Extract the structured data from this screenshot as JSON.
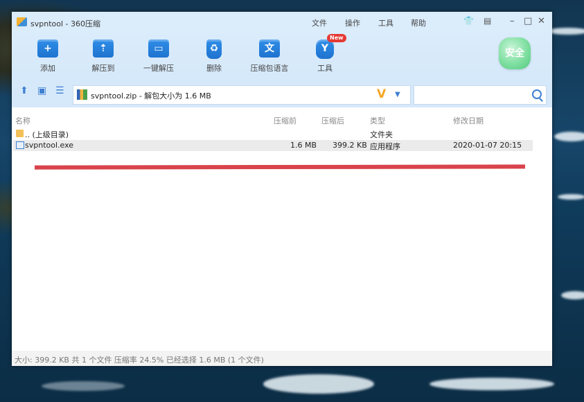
{
  "window": {
    "title": "svpntool - 360压缩",
    "menu": [
      "文件",
      "操作",
      "工具",
      "帮助"
    ],
    "controls": {
      "skin": "skin-icon",
      "feedback": "feedback-icon",
      "minimize": "–",
      "maximize": "□",
      "close": "✕"
    }
  },
  "toolbar": {
    "buttons": [
      {
        "label": "添加",
        "icon": "add-icon",
        "glyph": "+"
      },
      {
        "label": "解压到",
        "icon": "extract-to-icon",
        "glyph": "⇡"
      },
      {
        "label": "一键解压",
        "icon": "one-click-extract-icon",
        "glyph": "▭"
      },
      {
        "label": "删除",
        "icon": "recycle-bin-icon",
        "glyph": "♻"
      },
      {
        "label": "压缩包语言",
        "icon": "language-icon",
        "glyph": "文"
      },
      {
        "label": "工具",
        "icon": "tools-icon",
        "glyph": "Y",
        "badge": "New"
      }
    ],
    "safe_label": "安全"
  },
  "address": {
    "path": "svpntool.zip - 解包大小为 1.6 MB",
    "search_placeholder": ""
  },
  "table": {
    "headers": {
      "name": "名称",
      "before": "压缩前",
      "after": "压缩后",
      "type": "类型",
      "date": "修改日期"
    },
    "rows": [
      {
        "name": ".. (上级目录)",
        "before": "",
        "after": "",
        "type": "文件夹",
        "date": "",
        "icon": "folder-icon"
      },
      {
        "name": "svpntool.exe",
        "before": "1.6 MB",
        "after": "399.2 KB",
        "type": "应用程序",
        "date": "2020-01-07 20:15",
        "icon": "exe-icon"
      }
    ]
  },
  "status": {
    "text": "大小: 399.2 KB 共 1 个文件 压缩率 24.5% 已经选择 1.6 MB (1 个文件)"
  },
  "colors": {
    "accent": "#2f8ee8",
    "annotation_red": "#d9434b",
    "safe_green": "#55c983",
    "titlebar": "#dbecfb"
  }
}
